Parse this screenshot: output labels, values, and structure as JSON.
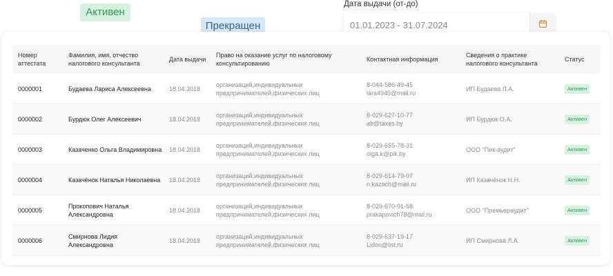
{
  "floating": {
    "status_active_label": "Активен",
    "status_terminated_label": "Прекращен"
  },
  "filter": {
    "date_label": "Дата выдачи (от-до)",
    "date_value": "01.01.2023 - 31.07.2024",
    "calendar_icon": "calendar-icon"
  },
  "table": {
    "headers": {
      "number": "Номер аттестата",
      "name": "Фамилия, имя, отчество налогового консультанта",
      "date": "Дата выдачи",
      "right": "Право на оказание услуг по налоговому консультированию",
      "contact": "Контактная информация",
      "practice": "Сведения о практике налогового консультанта",
      "status": "Статус"
    },
    "rows": [
      {
        "number": "0000001",
        "name": "Будаева Лариса Алексеевна",
        "date": "18.04.2018",
        "right": "организаций,индивидуальных предпринимателей,физических лиц",
        "phone": "8-044-586-49-45",
        "email": "lara4945@mail.ru",
        "practice": "ИП Будаева Л.А.",
        "status": "Активен"
      },
      {
        "number": "0000002",
        "name": "Бурдюк Олег Алексеевич",
        "date": "18.04.2018",
        "right": "организаций,индивидуальных предпринимателей,физических лиц",
        "phone": "8-029-627-10-77",
        "email": "ab@taxes.by",
        "practice": "ИП Бурдюк О.А.",
        "status": "Активен"
      },
      {
        "number": "0000003",
        "name": "Казаченко Ольга Владимировна",
        "date": "18.04.2018",
        "right": "организаций,индивидуальных предпринимателей,физических лиц",
        "phone": "8-029-655-78-31",
        "email": "olga.k@pik.by",
        "practice": "ООО \"Пик-аудит\"",
        "status": "Активен"
      },
      {
        "number": "0000004",
        "name": "Казачёнок Наталья Николаевна",
        "date": "18.04.2018",
        "right": "организаций,индивидуальных предпринимателей,физических лиц",
        "phone": "8-029-614-79-07",
        "email": "n.kazach@mail.ru",
        "practice": "ИП Казачёнок Н.Н.",
        "status": "Активен"
      },
      {
        "number": "0000005",
        "name": "Прокопович Наталья Александровна",
        "date": "18.04.2018",
        "right": "организаций,индивидуальных предпринимателей,физических лиц",
        "phone": "8-029-670-91-58",
        "email": "prakapovich78@mail.ru",
        "practice": "ООО \"Премьераудит\"",
        "status": "Активен"
      },
      {
        "number": "0000006",
        "name": "Смирнова Лидия Александровна",
        "date": "18.04.2018",
        "right": "организаций,индивидуальных предпринимателей,физических лиц",
        "phone": "8-029-637-19-17",
        "email": "Lidon@list.ru",
        "practice": "ИП Смирнова Л.А.",
        "status": "Активен"
      }
    ]
  }
}
